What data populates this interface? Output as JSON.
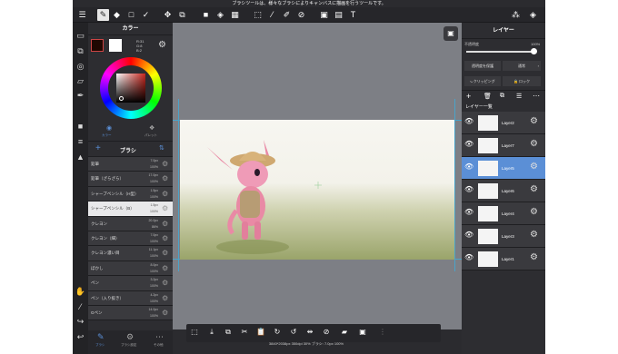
{
  "notice": "ブラシツールは、様々なブラシによりキャンバスに描画を行うツールです。",
  "color_panel": {
    "title": "カラー",
    "rgb": {
      "r": "R:31",
      "g": "G:8",
      "b": "B:2"
    },
    "tabs": [
      {
        "label": "カラー"
      },
      {
        "label": "パレット"
      }
    ]
  },
  "brush_panel": {
    "title": "ブラシ",
    "items": [
      {
        "name": "鉛筆",
        "size": "7.0px",
        "opacity": "100%"
      },
      {
        "name": "鉛筆（ざらざら）",
        "size": "17.0px",
        "opacity": "100%"
      },
      {
        "name": "シャープペンシル（H型）",
        "size": "1.5px",
        "opacity": "100%"
      },
      {
        "name": "シャープペンシル（B）",
        "size": "1.5px",
        "opacity": "100%"
      },
      {
        "name": "クレヨン",
        "size": "20.0px",
        "opacity": "86%"
      },
      {
        "name": "クレヨン（細）",
        "size": "7.0px",
        "opacity": "100%"
      },
      {
        "name": "クレヨン濃い目",
        "size": "11.1px",
        "opacity": "100%"
      },
      {
        "name": "ぼかし",
        "size": "8.0px",
        "opacity": "100%"
      },
      {
        "name": "ペン",
        "size": "3.2px",
        "opacity": "100%"
      },
      {
        "name": "ペン（入り抜き）",
        "size": "4.2px",
        "opacity": "100%"
      },
      {
        "name": "Gペン",
        "size": "14.0px",
        "opacity": "100%"
      }
    ],
    "bottom_tabs": [
      "ブラシ",
      "ブラシ設定",
      "その他"
    ]
  },
  "layer_panel": {
    "title": "レイヤー",
    "opacity_label": "不透明度",
    "opacity_value": "100%",
    "opacity_level": 1.0,
    "protect_button": "透明度を保護",
    "blend_mode": "通常",
    "clipping_label": "クリッピング",
    "lock_label": "ロック",
    "list_title": "レイヤー一覧",
    "layers": [
      {
        "name": "Layer2"
      },
      {
        "name": "Layer7"
      },
      {
        "name": "Layer5"
      },
      {
        "name": "Layer6"
      },
      {
        "name": "Layer4"
      },
      {
        "name": "Layer3"
      },
      {
        "name": "Layer1"
      }
    ]
  },
  "status": "3840*2038px 350dpi 30% ブラシ: 7.0px 100%",
  "accent_color": "#5b8fd6",
  "selected_brush_index": 3,
  "selected_layer_index": 2
}
